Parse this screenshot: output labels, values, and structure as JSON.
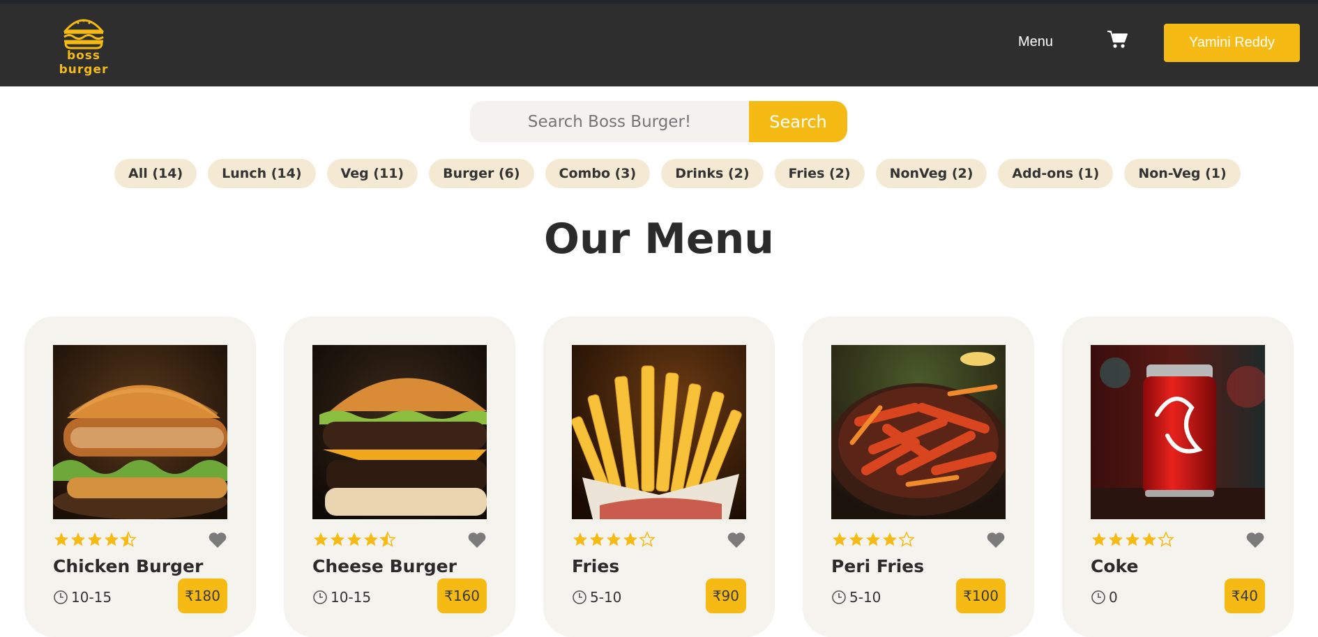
{
  "brand": {
    "logo_text": "boss burger",
    "accent": "#f5ba13",
    "header_bg": "#2e2e2e"
  },
  "nav": {
    "menu_label": "Menu",
    "user_label": "Yamini Reddy"
  },
  "search": {
    "placeholder": "Search Boss Burger!",
    "button_label": "Search"
  },
  "filters": [
    "All (14)",
    "Lunch (14)",
    "Veg (11)",
    "Burger (6)",
    "Combo (3)",
    "Drinks (2)",
    "Fries (2)",
    "NonVeg (2)",
    "Add-ons (1)",
    "Non-Veg (1)"
  ],
  "heading": "Our Menu",
  "items": [
    {
      "name": "Chicken Burger",
      "rating": 4.5,
      "time": "10-15",
      "price": "₹180",
      "image": "chicken-burger"
    },
    {
      "name": "Cheese Burger",
      "rating": 4.5,
      "time": "10-15",
      "price": "₹160",
      "image": "cheese-burger"
    },
    {
      "name": "Fries",
      "rating": 4,
      "time": "5-10",
      "price": "₹90",
      "image": "fries"
    },
    {
      "name": "Peri Fries",
      "rating": 4,
      "time": "5-10",
      "price": "₹100",
      "image": "peri-fries"
    },
    {
      "name": "Coke",
      "rating": 4,
      "time": "0",
      "price": "₹40",
      "image": "coke"
    }
  ]
}
